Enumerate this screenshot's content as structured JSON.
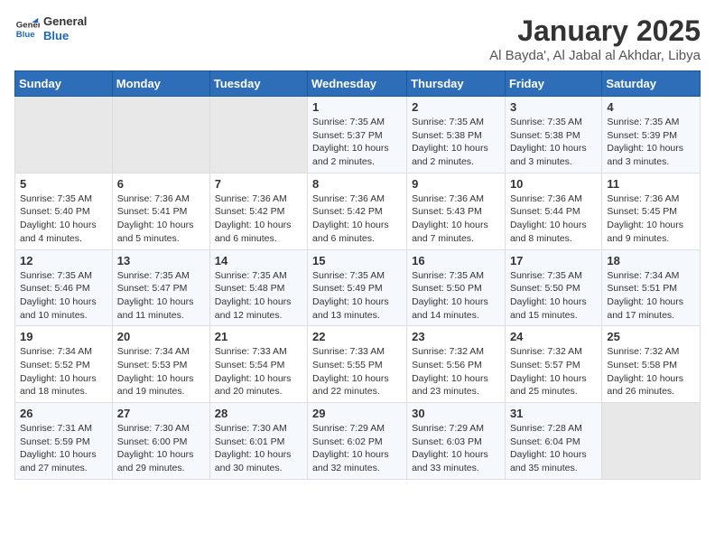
{
  "logo": {
    "line1": "General",
    "line2": "Blue"
  },
  "title": "January 2025",
  "subtitle": "Al Bayda', Al Jabal al Akhdar, Libya",
  "headers": [
    "Sunday",
    "Monday",
    "Tuesday",
    "Wednesday",
    "Thursday",
    "Friday",
    "Saturday"
  ],
  "weeks": [
    [
      {
        "day": "",
        "sunrise": "",
        "sunset": "",
        "daylight": ""
      },
      {
        "day": "",
        "sunrise": "",
        "sunset": "",
        "daylight": ""
      },
      {
        "day": "",
        "sunrise": "",
        "sunset": "",
        "daylight": ""
      },
      {
        "day": "1",
        "sunrise": "Sunrise: 7:35 AM",
        "sunset": "Sunset: 5:37 PM",
        "daylight": "Daylight: 10 hours and 2 minutes."
      },
      {
        "day": "2",
        "sunrise": "Sunrise: 7:35 AM",
        "sunset": "Sunset: 5:38 PM",
        "daylight": "Daylight: 10 hours and 2 minutes."
      },
      {
        "day": "3",
        "sunrise": "Sunrise: 7:35 AM",
        "sunset": "Sunset: 5:38 PM",
        "daylight": "Daylight: 10 hours and 3 minutes."
      },
      {
        "day": "4",
        "sunrise": "Sunrise: 7:35 AM",
        "sunset": "Sunset: 5:39 PM",
        "daylight": "Daylight: 10 hours and 3 minutes."
      }
    ],
    [
      {
        "day": "5",
        "sunrise": "Sunrise: 7:35 AM",
        "sunset": "Sunset: 5:40 PM",
        "daylight": "Daylight: 10 hours and 4 minutes."
      },
      {
        "day": "6",
        "sunrise": "Sunrise: 7:36 AM",
        "sunset": "Sunset: 5:41 PM",
        "daylight": "Daylight: 10 hours and 5 minutes."
      },
      {
        "day": "7",
        "sunrise": "Sunrise: 7:36 AM",
        "sunset": "Sunset: 5:42 PM",
        "daylight": "Daylight: 10 hours and 6 minutes."
      },
      {
        "day": "8",
        "sunrise": "Sunrise: 7:36 AM",
        "sunset": "Sunset: 5:42 PM",
        "daylight": "Daylight: 10 hours and 6 minutes."
      },
      {
        "day": "9",
        "sunrise": "Sunrise: 7:36 AM",
        "sunset": "Sunset: 5:43 PM",
        "daylight": "Daylight: 10 hours and 7 minutes."
      },
      {
        "day": "10",
        "sunrise": "Sunrise: 7:36 AM",
        "sunset": "Sunset: 5:44 PM",
        "daylight": "Daylight: 10 hours and 8 minutes."
      },
      {
        "day": "11",
        "sunrise": "Sunrise: 7:36 AM",
        "sunset": "Sunset: 5:45 PM",
        "daylight": "Daylight: 10 hours and 9 minutes."
      }
    ],
    [
      {
        "day": "12",
        "sunrise": "Sunrise: 7:35 AM",
        "sunset": "Sunset: 5:46 PM",
        "daylight": "Daylight: 10 hours and 10 minutes."
      },
      {
        "day": "13",
        "sunrise": "Sunrise: 7:35 AM",
        "sunset": "Sunset: 5:47 PM",
        "daylight": "Daylight: 10 hours and 11 minutes."
      },
      {
        "day": "14",
        "sunrise": "Sunrise: 7:35 AM",
        "sunset": "Sunset: 5:48 PM",
        "daylight": "Daylight: 10 hours and 12 minutes."
      },
      {
        "day": "15",
        "sunrise": "Sunrise: 7:35 AM",
        "sunset": "Sunset: 5:49 PM",
        "daylight": "Daylight: 10 hours and 13 minutes."
      },
      {
        "day": "16",
        "sunrise": "Sunrise: 7:35 AM",
        "sunset": "Sunset: 5:50 PM",
        "daylight": "Daylight: 10 hours and 14 minutes."
      },
      {
        "day": "17",
        "sunrise": "Sunrise: 7:35 AM",
        "sunset": "Sunset: 5:50 PM",
        "daylight": "Daylight: 10 hours and 15 minutes."
      },
      {
        "day": "18",
        "sunrise": "Sunrise: 7:34 AM",
        "sunset": "Sunset: 5:51 PM",
        "daylight": "Daylight: 10 hours and 17 minutes."
      }
    ],
    [
      {
        "day": "19",
        "sunrise": "Sunrise: 7:34 AM",
        "sunset": "Sunset: 5:52 PM",
        "daylight": "Daylight: 10 hours and 18 minutes."
      },
      {
        "day": "20",
        "sunrise": "Sunrise: 7:34 AM",
        "sunset": "Sunset: 5:53 PM",
        "daylight": "Daylight: 10 hours and 19 minutes."
      },
      {
        "day": "21",
        "sunrise": "Sunrise: 7:33 AM",
        "sunset": "Sunset: 5:54 PM",
        "daylight": "Daylight: 10 hours and 20 minutes."
      },
      {
        "day": "22",
        "sunrise": "Sunrise: 7:33 AM",
        "sunset": "Sunset: 5:55 PM",
        "daylight": "Daylight: 10 hours and 22 minutes."
      },
      {
        "day": "23",
        "sunrise": "Sunrise: 7:32 AM",
        "sunset": "Sunset: 5:56 PM",
        "daylight": "Daylight: 10 hours and 23 minutes."
      },
      {
        "day": "24",
        "sunrise": "Sunrise: 7:32 AM",
        "sunset": "Sunset: 5:57 PM",
        "daylight": "Daylight: 10 hours and 25 minutes."
      },
      {
        "day": "25",
        "sunrise": "Sunrise: 7:32 AM",
        "sunset": "Sunset: 5:58 PM",
        "daylight": "Daylight: 10 hours and 26 minutes."
      }
    ],
    [
      {
        "day": "26",
        "sunrise": "Sunrise: 7:31 AM",
        "sunset": "Sunset: 5:59 PM",
        "daylight": "Daylight: 10 hours and 27 minutes."
      },
      {
        "day": "27",
        "sunrise": "Sunrise: 7:30 AM",
        "sunset": "Sunset: 6:00 PM",
        "daylight": "Daylight: 10 hours and 29 minutes."
      },
      {
        "day": "28",
        "sunrise": "Sunrise: 7:30 AM",
        "sunset": "Sunset: 6:01 PM",
        "daylight": "Daylight: 10 hours and 30 minutes."
      },
      {
        "day": "29",
        "sunrise": "Sunrise: 7:29 AM",
        "sunset": "Sunset: 6:02 PM",
        "daylight": "Daylight: 10 hours and 32 minutes."
      },
      {
        "day": "30",
        "sunrise": "Sunrise: 7:29 AM",
        "sunset": "Sunset: 6:03 PM",
        "daylight": "Daylight: 10 hours and 33 minutes."
      },
      {
        "day": "31",
        "sunrise": "Sunrise: 7:28 AM",
        "sunset": "Sunset: 6:04 PM",
        "daylight": "Daylight: 10 hours and 35 minutes."
      },
      {
        "day": "",
        "sunrise": "",
        "sunset": "",
        "daylight": ""
      }
    ]
  ]
}
